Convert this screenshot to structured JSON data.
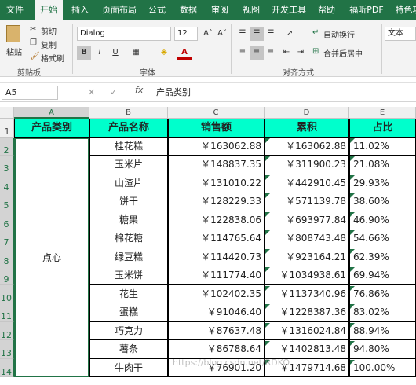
{
  "tabs": [
    "文件",
    "开始",
    "插入",
    "页面布局",
    "公式",
    "数据",
    "审阅",
    "视图",
    "开发工具",
    "帮助",
    "福昕PDF",
    "特色功"
  ],
  "ribbon": {
    "paste": "粘贴",
    "cut": "剪切",
    "copy": "复制",
    "format_painter": "格式刷",
    "clipboard_group": "剪贴板",
    "font_name": "Dialog",
    "font_size": "12",
    "bold": "B",
    "italic": "I",
    "underline": "U",
    "font_group": "字体",
    "wrap_text": "自动换行",
    "merge_center": "合并后居中",
    "align_group": "对齐方式",
    "number_format": "文本"
  },
  "formula_bar": {
    "name_box": "A5",
    "fx": "fx",
    "content": "产品类别"
  },
  "columns": [
    "A",
    "B",
    "C",
    "D",
    "E"
  ],
  "rows": [
    "1",
    "2",
    "3",
    "4",
    "5",
    "6",
    "7",
    "8",
    "9",
    "10",
    "11",
    "12",
    "13",
    "14"
  ],
  "table": {
    "headers": [
      "产品类别",
      "产品名称",
      "销售额",
      "累积",
      "占比"
    ],
    "category": "点心",
    "rows": [
      {
        "name": "桂花糕",
        "sales": "￥163062.88",
        "cumul": "￥163062.88",
        "pct": "11.02%"
      },
      {
        "name": "玉米片",
        "sales": "￥148837.35",
        "cumul": "￥311900.23",
        "pct": "21.08%"
      },
      {
        "name": "山渣片",
        "sales": "￥131010.22",
        "cumul": "￥442910.45",
        "pct": "29.93%"
      },
      {
        "name": "饼干",
        "sales": "￥128229.33",
        "cumul": "￥571139.78",
        "pct": "38.60%"
      },
      {
        "name": "糖果",
        "sales": "￥122838.06",
        "cumul": "￥693977.84",
        "pct": "46.90%"
      },
      {
        "name": "棉花糖",
        "sales": "￥114765.64",
        "cumul": "￥808743.48",
        "pct": "54.66%"
      },
      {
        "name": "绿豆糕",
        "sales": "￥114420.73",
        "cumul": "￥923164.21",
        "pct": "62.39%"
      },
      {
        "name": "玉米饼",
        "sales": "￥111774.40",
        "cumul": "￥1034938.61",
        "pct": "69.94%"
      },
      {
        "name": "花生",
        "sales": "￥102402.35",
        "cumul": "￥1137340.96",
        "pct": "76.86%"
      },
      {
        "name": "蛋糕",
        "sales": "￥91046.40",
        "cumul": "￥1228387.36",
        "pct": "83.02%"
      },
      {
        "name": "巧克力",
        "sales": "￥87637.48",
        "cumul": "￥1316024.84",
        "pct": "88.94%"
      },
      {
        "name": "薯条",
        "sales": "￥86788.64",
        "cumul": "￥1402813.48",
        "pct": "94.80%"
      },
      {
        "name": "牛肉干",
        "sales": "￥76901.20",
        "cumul": "￥1479714.68",
        "pct": "100.00%"
      }
    ]
  },
  "watermark": "https://blog.csdn.net/RDKO...",
  "colors": {
    "excel_green": "#217346",
    "header_fill": "#00ffcc"
  }
}
